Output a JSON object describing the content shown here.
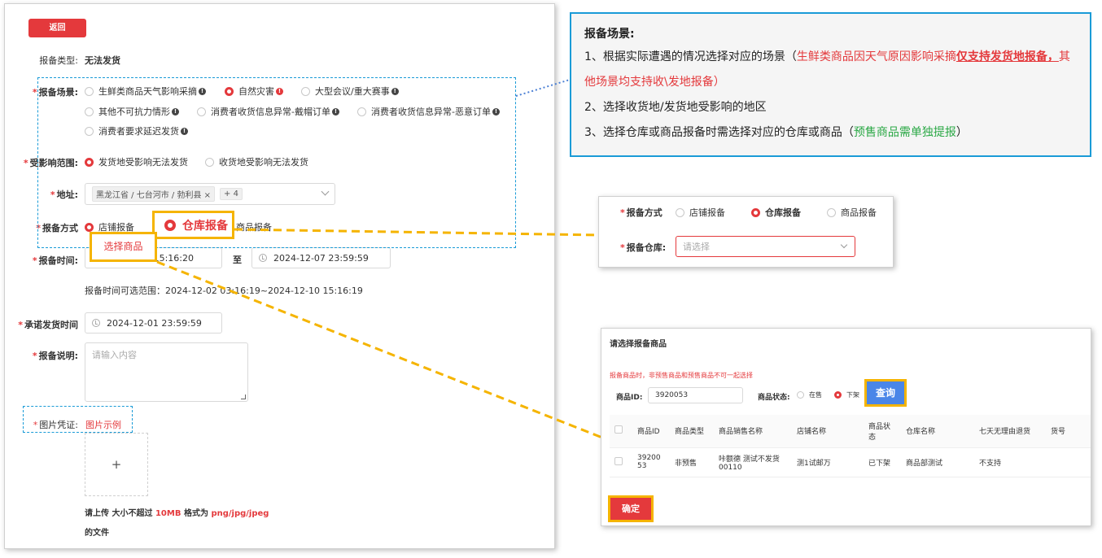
{
  "form": {
    "back_button": "返回",
    "type_label": "报备类型:",
    "type_value": "无法发货",
    "scene_label": "报备场景:",
    "scene_options": [
      "生鲜类商品天气影响采摘",
      "自然灾害",
      "大型会议/重大赛事",
      "其他不可抗力情形",
      "消费者收货信息异常-戴帽订单",
      "消费者收货信息异常-恶意订单",
      "消费者要求延迟发货"
    ],
    "scope_label": "受影响范围:",
    "scope_options": [
      "发货地受影响无法发货",
      "收货地受影响无法发货"
    ],
    "address_label": "地址:",
    "address_tag": "黑龙江省 / 七台河市 / 勃利县",
    "address_tag_close": "×",
    "address_more": "+ 4",
    "method_label": "报备方式",
    "method_option_1": "店铺报备",
    "method_overlay": "仓库报备",
    "method_option_3_tail": "商品报备",
    "select_goods": "选择商品",
    "time_label": "报备时间:",
    "time_start": "15:16:20",
    "time_to": "至",
    "time_end": "2024-12-07 23:59:59",
    "time_range_note": "报备时间可选范围：2024-12-02 03:16:19~2024-12-10 15:16:19",
    "promise_label": "承诺发货时间",
    "promise_value": "2024-12-01 23:59:59",
    "desc_label": "报备说明:",
    "desc_placeholder": "请输入内容",
    "img_label": "图片凭证:",
    "img_example": "图片示例",
    "upload_plus": "+",
    "upload_note_1": "请上传 大小不超过 ",
    "upload_size": "10MB",
    "upload_note_2": " 格式为 ",
    "upload_formats": "png/jpg/jpeg",
    "upload_note_3": "的文件"
  },
  "notes": {
    "title": "报备场景:",
    "line1_a": "1、根据实际遭遇的情况选择对应的场景（",
    "line1_b": "生鲜类商品因天气原因影响采摘",
    "line1_c": "仅支持发货地报备，",
    "line1_d": "其他场景均支持收\\发地报备）",
    "line2": "2、选择收货地/发货地受影响的地区",
    "line3_a": "3、选择仓库或商品报备时需选择对应的仓库或商品（",
    "line3_b": "预售商品需单独提报",
    "line3_c": "）"
  },
  "warehouse_panel": {
    "method_label": "报备方式",
    "options": [
      "店铺报备",
      "仓库报备",
      "商品报备"
    ],
    "warehouse_label": "报备仓库:",
    "warehouse_placeholder": "请选择"
  },
  "goods_panel": {
    "title": "请选择报备商品",
    "warning": "报备商品时，非预售商品和预售商品不可一起选择",
    "id_label": "商品ID:",
    "id_value": "3920053",
    "status_label": "商品状态:",
    "status_options": [
      "在售",
      "下架"
    ],
    "query_button": "查询",
    "columns": [
      "商品ID",
      "商品类型",
      "商品销售名称",
      "店铺名称",
      "商品状态",
      "仓库名称",
      "七天无理由退货",
      "货号"
    ],
    "rows": [
      [
        "3920053",
        "非预售",
        "咔额德 测试不发货00110",
        "测1试邮万",
        "已下架",
        "商品部测试",
        "不支持",
        ""
      ]
    ],
    "confirm_button": "确定"
  },
  "colors": {
    "accent_red": "#e4393c",
    "highlight_yellow": "#f5b400",
    "annotation_blue": "#1a9bd7",
    "note_green": "#2aa845"
  }
}
